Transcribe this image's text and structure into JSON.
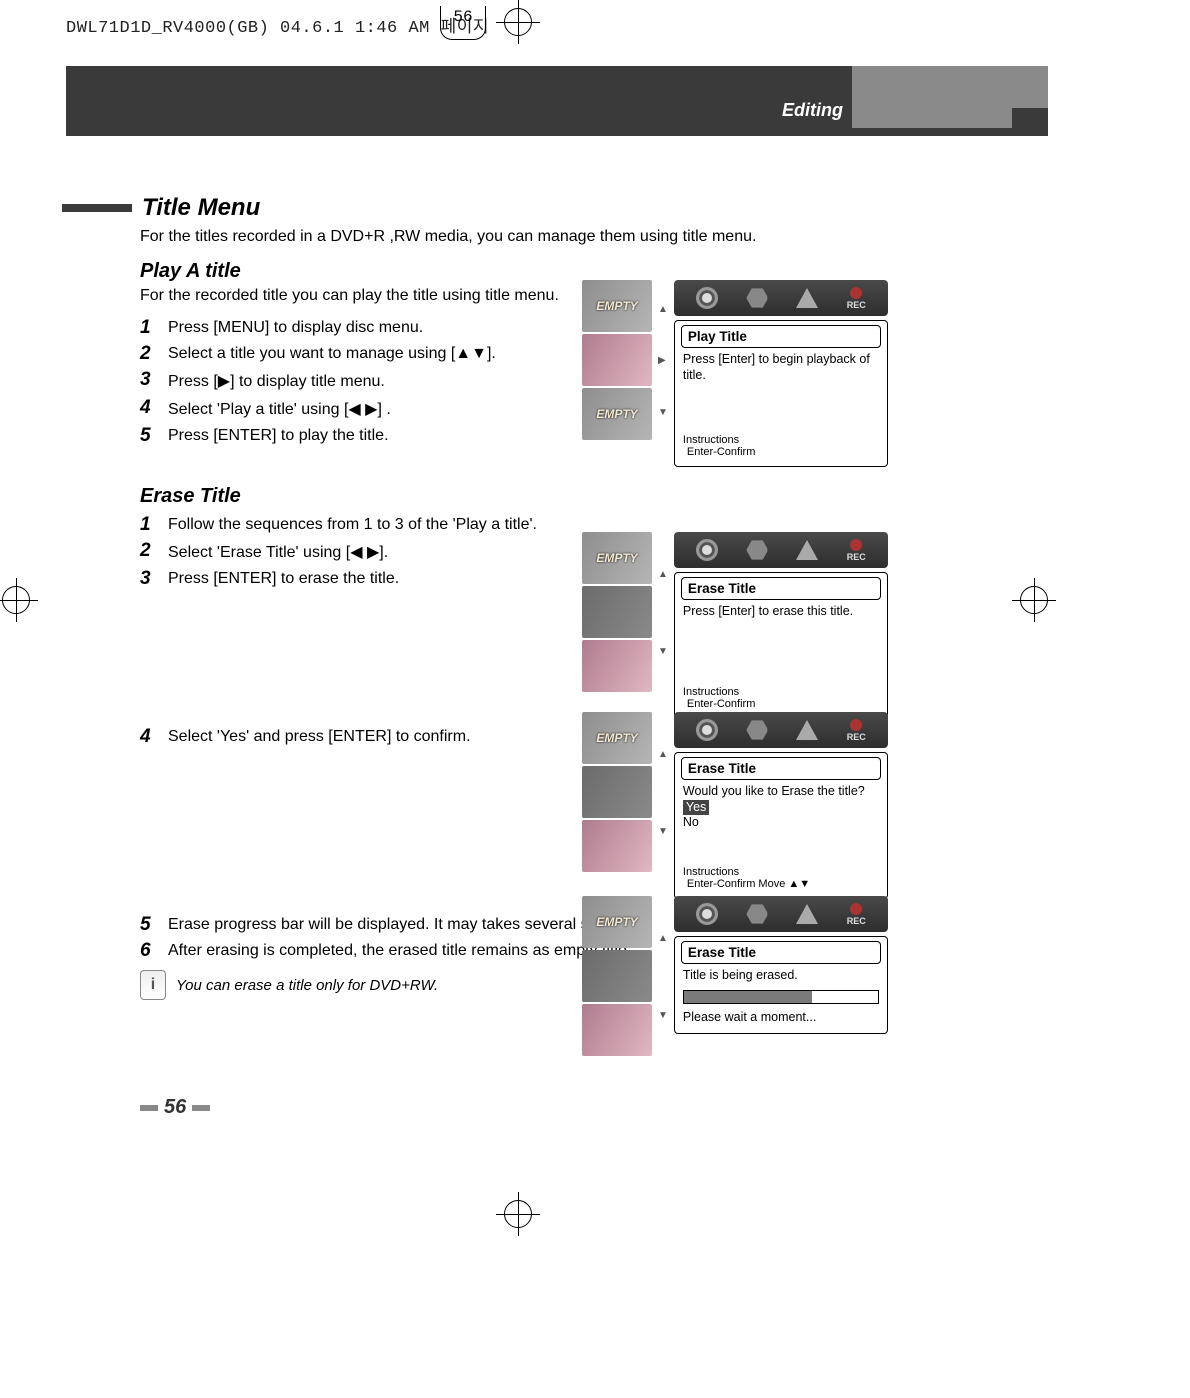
{
  "print_header": "DWL71D1D_RV4000(GB)  04.6.1 1:46 AM  페이지",
  "print_page_inbox": "56",
  "band_label": "Editing",
  "page_number": "56",
  "title_menu": {
    "heading": "Title Menu",
    "intro": "For the titles recorded in a DVD+R ,RW media, you can manage them using title menu."
  },
  "play_a_title": {
    "heading": "Play A title",
    "intro": "For the recorded title you can play the title using title menu.",
    "steps": [
      "Press [MENU] to display disc menu.",
      "Select a title you want to manage using [▲▼].",
      " Press [▶] to display title menu.",
      "Select 'Play a title' using [◀ ▶] .",
      "Press [ENTER] to play the title."
    ]
  },
  "erase_title": {
    "heading": "Erase Title",
    "steps_a": [
      "Follow the sequences from 1 to 3 of the 'Play a title'.",
      "Select 'Erase Title' using [◀ ▶].",
      "Press [ENTER] to erase the title."
    ],
    "step4": "Select 'Yes'  and press [ENTER] to confirm.",
    "step5": "Erase progress bar will be displayed. It may takes several seconds.",
    "step6": "After erasing is completed, the erased title remains as empty title.",
    "note": "You can erase a title only for DVD+RW."
  },
  "thumbs": {
    "empty": "EMPTY"
  },
  "icons": {
    "rec": "REC"
  },
  "panel_play": {
    "title": "Play Title",
    "body": "Press [Enter] to begin playback of title.",
    "foot1": "Instructions",
    "foot2": "Enter-Confirm"
  },
  "panel_erase1": {
    "title": "Erase Title",
    "body": "Press [Enter] to erase this title.",
    "foot1": "Instructions",
    "foot2": "Enter-Confirm"
  },
  "panel_erase2": {
    "title": "Erase Title",
    "question": "Would you like to Erase the title?",
    "opt_yes": "Yes",
    "opt_no": "No",
    "foot1": "Instructions",
    "foot2": "Enter-Confirm   Move ▲▼"
  },
  "panel_erase3": {
    "title": "Erase Title",
    "line1": "Title is being erased.",
    "line2": "Please wait a moment..."
  }
}
